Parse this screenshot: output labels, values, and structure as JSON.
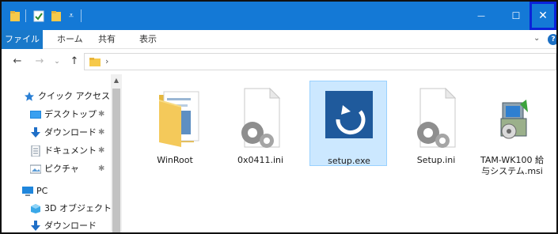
{
  "titlebar": {
    "quick_access": [
      "folder-icon",
      "properties-check-icon",
      "new-folder-icon",
      "customize-dropdown-icon"
    ],
    "minimize_glyph": "—",
    "maximize_glyph": "☐",
    "close_glyph": "✕",
    "accent": "#1479d6",
    "close_highlight": "#0a22d9"
  },
  "ribbon": {
    "file_tab": "ファイル",
    "tabs": [
      "ホーム",
      "共有",
      "表示"
    ],
    "expand_glyph": "⌄",
    "help_glyph": "?",
    "file_tab_color": "#1979ca"
  },
  "addressbar": {
    "back_glyph": "←",
    "forward_glyph": "→",
    "recent_glyph": "⌄",
    "up_glyph": "↑",
    "crumb_sep": "›"
  },
  "navpane": {
    "quick_access_label": "クイック アクセス",
    "items": [
      {
        "label": "デスクトップ",
        "icon": "desktop-icon",
        "pinned": true
      },
      {
        "label": "ダウンロード",
        "icon": "download-icon",
        "pinned": true
      },
      {
        "label": "ドキュメント",
        "icon": "documents-icon",
        "pinned": true
      },
      {
        "label": "ピクチャ",
        "icon": "pictures-icon",
        "pinned": true
      }
    ],
    "pc_label": "PC",
    "pc_items": [
      {
        "label": "3D オブジェクト",
        "icon": "3d-objects-icon"
      },
      {
        "label": "ダウンロード",
        "icon": "download-icon"
      }
    ],
    "pin_glyph": "📌",
    "scroll_up_glyph": "▲"
  },
  "files": [
    {
      "name": "WinRoot",
      "type": "folder"
    },
    {
      "name": "0x0411.ini",
      "type": "ini"
    },
    {
      "name": "setup.exe",
      "type": "exe",
      "selected": true
    },
    {
      "name": "Setup.ini",
      "type": "ini"
    },
    {
      "name": "TAM-WK100 給与システム.msi",
      "name_line1": "TAM-WK100 給",
      "name_line2": "与システム.msi",
      "type": "msi"
    }
  ]
}
